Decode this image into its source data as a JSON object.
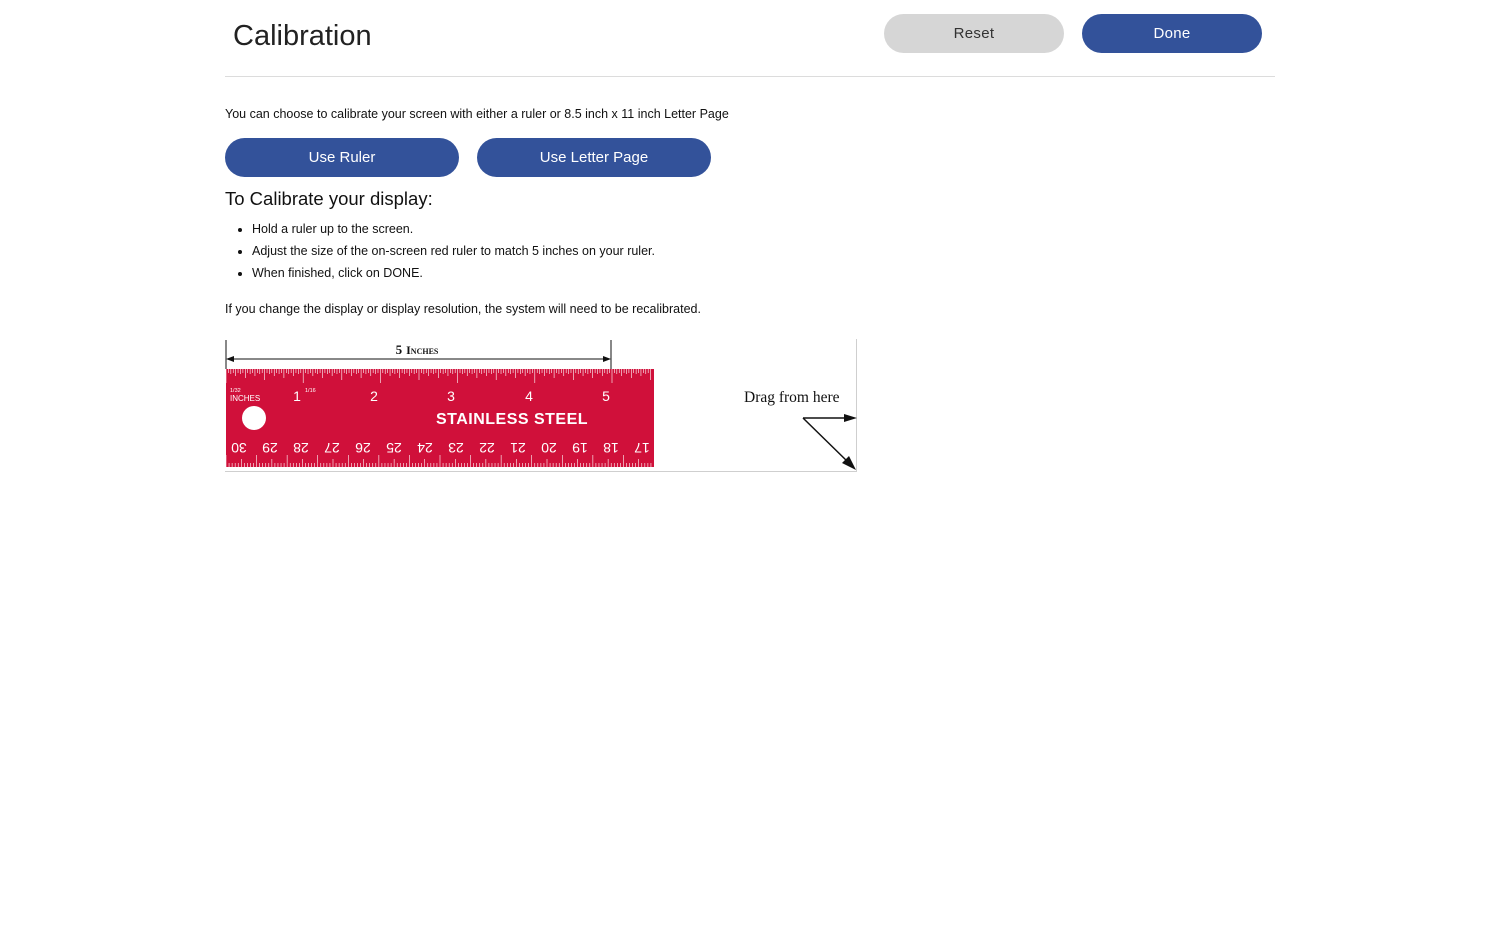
{
  "header": {
    "title": "Calibration",
    "reset_label": "Reset",
    "done_label": "Done"
  },
  "intro": {
    "text": "You can choose to calibrate your screen with either a ruler or 8.5 inch x 11 inch Letter Page"
  },
  "modes": {
    "ruler_label": "Use Ruler",
    "letter_label": "Use Letter Page"
  },
  "instructions": {
    "heading": "To Calibrate your display:",
    "steps": [
      "Hold a ruler up to the screen.",
      "Adjust the size of the on-screen red ruler to match 5 inches on your ruler.",
      "When finished, click on DONE."
    ],
    "note": "If you change the display or display resolution, the system will need to be recalibrated."
  },
  "ruler": {
    "span_label_number": "5",
    "span_label_unit": "Inches",
    "units_label": "INCHES",
    "fraction_32": "1/32",
    "fraction_16": "1/16",
    "brand_text": "STAINLESS STEEL",
    "inch_numbers": [
      "1",
      "2",
      "3",
      "4",
      "5"
    ],
    "cm_numbers": [
      "30",
      "29",
      "28",
      "27",
      "26",
      "25",
      "24",
      "23",
      "22",
      "21",
      "20",
      "19",
      "18",
      "17"
    ],
    "drag_hint": "Drag from here",
    "ruler_color": "#d0103a",
    "hole_color": "#ffffff",
    "arrow_icon": "drag-arrow-icon"
  },
  "colors": {
    "primary": "#33529a",
    "secondary": "#d6d6d6"
  }
}
